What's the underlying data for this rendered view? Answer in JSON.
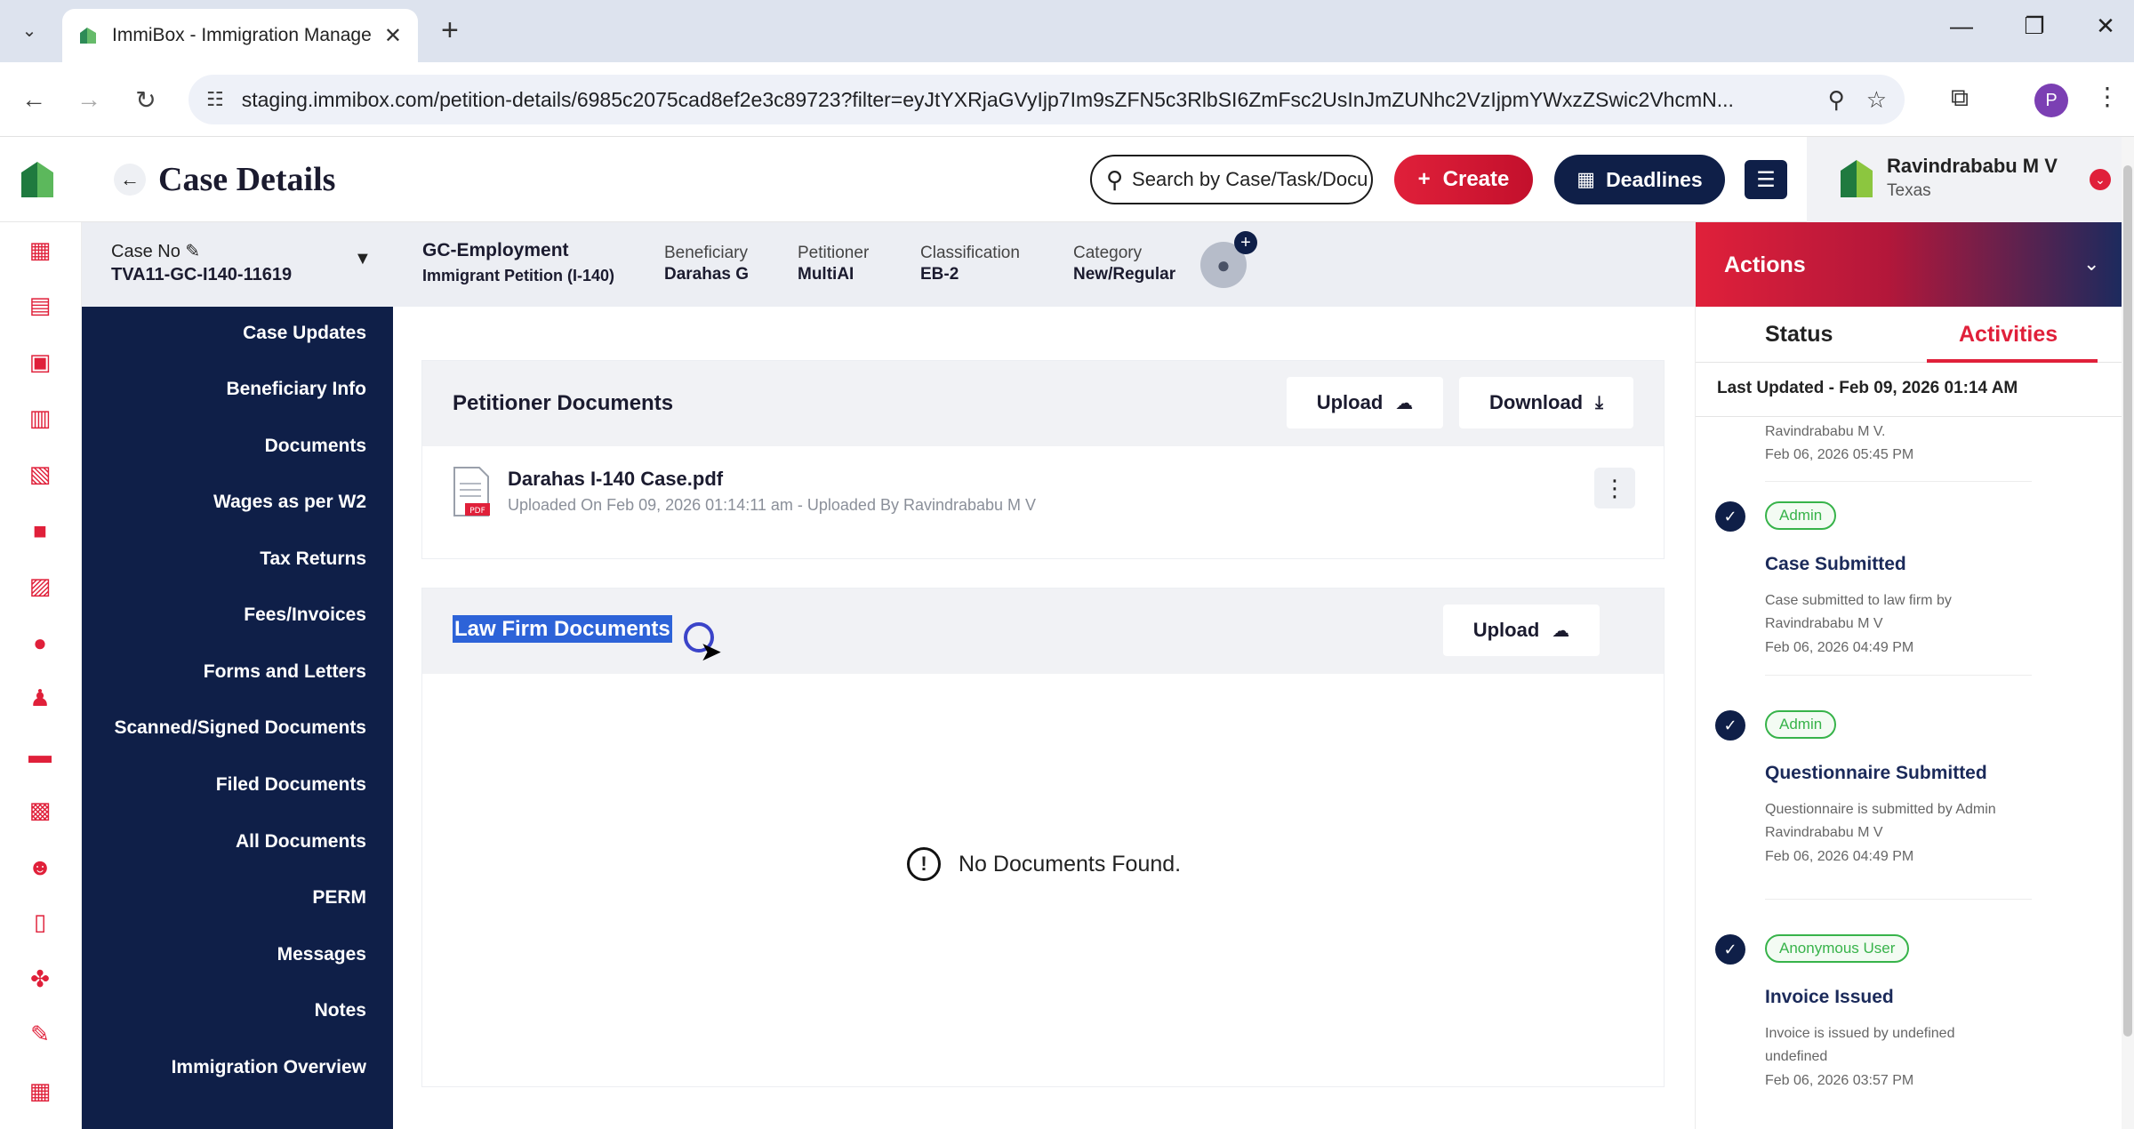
{
  "browser": {
    "tab_title": "ImmiBox - Immigration Manage",
    "url": "staging.immibox.com/petition-details/6985c2075cad8ef2e3c89723?filter=eyJtYXRjaGVyIjp7Im9sZFN5c3RlbSI6ZmFsc2UsInJmZUNhc2VzIjpmYWxzZSwic2VhcmN...",
    "profile_initial": "P"
  },
  "header": {
    "title": "Case Details",
    "search_placeholder": "Search by Case/Task/Docu",
    "create_label": "Create",
    "deadlines_label": "Deadlines",
    "user_name": "Ravindrababu M V",
    "user_state": "Texas"
  },
  "case": {
    "case_no_label": "Case No",
    "case_no": "TVA11-GC-I140-11619",
    "type_title": "GC-Employment",
    "type_sub": "Immigrant Petition (I-140)",
    "beneficiary_label": "Beneficiary",
    "beneficiary": "Darahas G",
    "petitioner_label": "Petitioner",
    "petitioner": "MultiAI",
    "classification_label": "Classification",
    "classification": "EB-2",
    "category_label": "Category",
    "category": "New/Regular"
  },
  "subnav": [
    "Case Updates",
    "Beneficiary Info",
    "Documents",
    "Wages as per W2",
    "Tax Returns",
    "Fees/Invoices",
    "Forms and Letters",
    "Scanned/Signed Documents",
    "Filed Documents",
    "All Documents",
    "PERM",
    "Messages",
    "Notes",
    "Immigration Overview"
  ],
  "petitioner_docs": {
    "title": "Petitioner Documents",
    "upload_label": "Upload",
    "download_label": "Download",
    "file_name": "Darahas I-140 Case.pdf",
    "file_meta": "Uploaded On Feb 09, 2026 01:14:11 am - Uploaded By Ravindrababu M V",
    "file_badge": "PDF"
  },
  "lawfirm_docs": {
    "title": "Law Firm Documents",
    "upload_label": "Upload",
    "empty_text": "No Documents Found."
  },
  "actions": {
    "title": "Actions",
    "tab_status": "Status",
    "tab_activities": "Activities",
    "last_updated": "Last Updated - Feb 09, 2026 01:14 AM",
    "partial_entry": {
      "line1": "Ravindrababu M V.",
      "line2": "Feb 06, 2026 05:45 PM"
    },
    "activities": [
      {
        "badge": "Admin",
        "title": "Case Submitted",
        "desc1": "Case submitted to law firm by",
        "desc2": "Ravindrababu M V",
        "date": "Feb 06, 2026 04:49 PM"
      },
      {
        "badge": "Admin",
        "title": "Questionnaire Submitted",
        "desc1": "Questionnaire is submitted by Admin",
        "desc2": "Ravindrababu M V",
        "date": "Feb 06, 2026 04:49 PM"
      },
      {
        "badge": "Anonymous User",
        "title": "Invoice Issued",
        "desc1": "Invoice is issued by undefined",
        "desc2": "undefined",
        "date": "Feb 06, 2026 03:57 PM"
      }
    ]
  },
  "colors": {
    "accent_red": "#e0203a",
    "navy": "#0f1f48",
    "badge_green": "#37b34a"
  }
}
